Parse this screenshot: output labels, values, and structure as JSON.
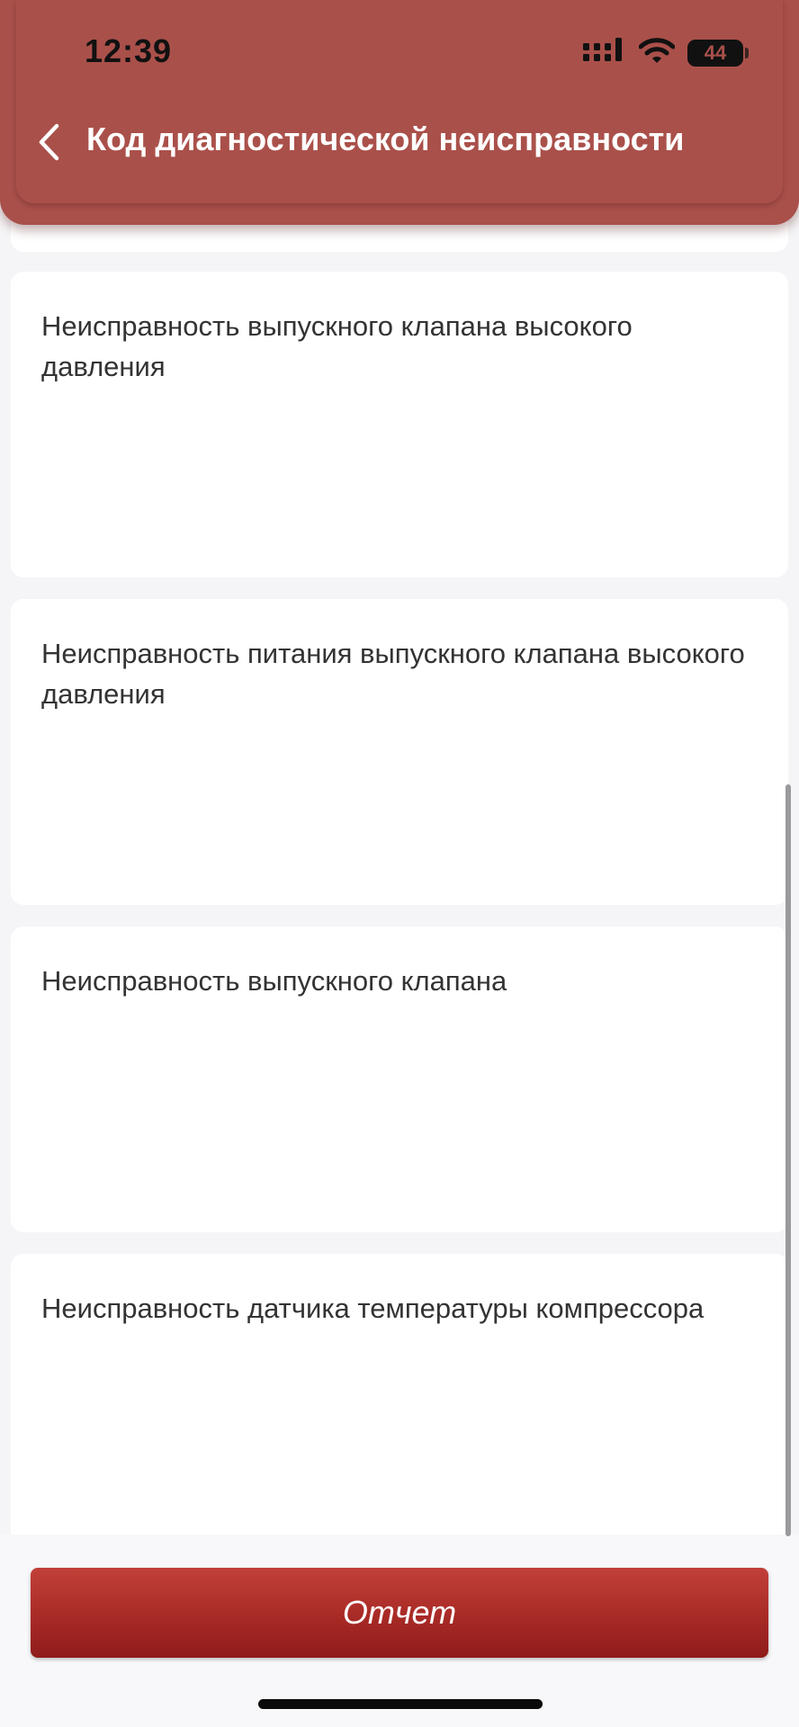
{
  "status_bar": {
    "time": "12:39",
    "battery": "44",
    "signal_icon": "cellular-signal-icon",
    "wifi_icon": "wifi-icon"
  },
  "header": {
    "title": "Код диагностической неисправности",
    "back_icon": "chevron-left-icon",
    "color": "#a9504b"
  },
  "faults": [
    {
      "description": "Неисправность выпускного клапана высокого давления"
    },
    {
      "description": "Неисправность питания выпускного клапана высокого давления"
    },
    {
      "description": "Неисправность выпускного клапана"
    },
    {
      "description": "Неисправность датчика температуры компрессора"
    }
  ],
  "footer": {
    "report_label": "Отчет",
    "button_color": "#a82a26"
  }
}
